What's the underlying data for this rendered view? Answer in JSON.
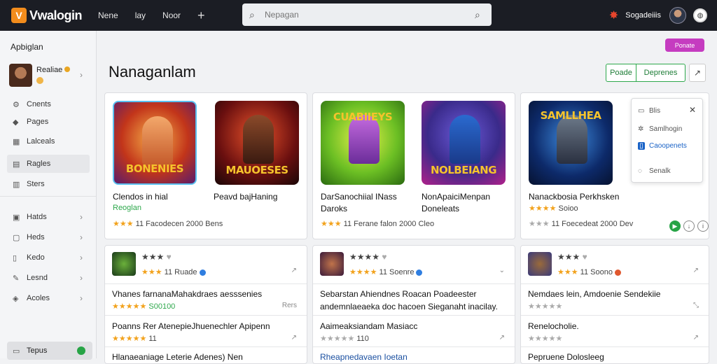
{
  "app": {
    "name": "Vwalogin",
    "logo_glyph": "V"
  },
  "topnav": {
    "items": [
      "Nene",
      "lay",
      "Noor"
    ],
    "plus": "+"
  },
  "search": {
    "placeholder": "Nepagan"
  },
  "user": {
    "name": "Sogadeiiis"
  },
  "sidebar": {
    "title": "Apbiglan",
    "profile_name": "Realiae",
    "items": [
      {
        "label": "Cnents",
        "icon": "gear-icon"
      },
      {
        "label": "Pages",
        "icon": "tag-icon"
      },
      {
        "label": "Lalceals",
        "icon": "grid-icon"
      },
      {
        "label": "Ragles",
        "icon": "list-icon"
      },
      {
        "label": "Sters",
        "icon": "chart-icon"
      },
      {
        "label": "Hatds",
        "icon": "box-icon"
      },
      {
        "label": "Heds",
        "icon": "window-icon"
      },
      {
        "label": "Kedo",
        "icon": "doc-icon"
      },
      {
        "label": "Lesnd",
        "icon": "pen-icon"
      },
      {
        "label": "Acoles",
        "icon": "layers-icon"
      }
    ],
    "footer": "Tepus"
  },
  "main": {
    "title": "Nanaganlam",
    "pill": "Ponate",
    "btn_a": "Poade",
    "btn_b": "Deprenes"
  },
  "featured": [
    {
      "thumb_text": "BONENIES",
      "title": "Clendos in  hial",
      "sub": "Reoglan",
      "stars": "★★★",
      "rating": "11  Facodecen    2000 Bens"
    },
    {
      "thumb_text": "MAUOESES",
      "title": "Peavd bajHaning",
      "sub": "",
      "stars": "",
      "rating": ""
    },
    {
      "thumb_text": "CUABIIEYS",
      "title": "DarSanochiial  INass",
      "sub": "Daroks",
      "stars": "★★★",
      "rating": "11  Ferane falon     2000 Cleo"
    },
    {
      "thumb_text": "NOLBEIANG",
      "title": "NonApaiciMenpan",
      "sub": "Doneleats",
      "stars": "",
      "rating": ""
    },
    {
      "thumb_text": "SAMLLHEA",
      "title": "Nanackbosia  Perkhsken",
      "sub": "Soioo",
      "stars": "★★★★",
      "rating": "11  Foecedeat    2000  Dev"
    }
  ],
  "popover": {
    "r1": "Blis",
    "r2": "Samlhogin",
    "r3": "Caoopenets",
    "r4": "Senalk"
  },
  "list_cards": [
    {
      "head_stars": "★★★",
      "head_meta": "11  Ruade",
      "rows": [
        {
          "text": "Vhanes  farnanaMahakdraes aesssenies",
          "meta": "S00100",
          "right": "Rers"
        },
        {
          "text": "Poanns  Rer  AtenepieJhuenechler  Apipenn",
          "meta": "11",
          "right": ""
        },
        {
          "text": "Hlanaeaniage  Leterie  Adenes)  Nen",
          "meta": "",
          "right": ""
        }
      ]
    },
    {
      "head_stars": "★★★★",
      "head_meta": "11  Soenre",
      "rows": [
        {
          "text": "Sebarstan  Ahiendnes  Roacan  Poadeester",
          "meta": "",
          "right": ""
        },
        {
          "text": "andemnlaeaeka  doc hacoen  Sieganaht  inacilay.",
          "meta": "",
          "right": ""
        },
        {
          "text": "Aaimeaksiandam  Masiacc",
          "meta": "110",
          "right": ""
        },
        {
          "text": "Rheapnedavaen  Ioetan",
          "meta": "",
          "right": ""
        }
      ]
    },
    {
      "head_stars": "★★★",
      "head_meta": "11  Soono",
      "rows": [
        {
          "text": "Nemdaes lein,  Amdoenie  Sendekiie",
          "meta": "",
          "right": ""
        },
        {
          "text": "Renelocholie.",
          "meta": "",
          "right": ""
        },
        {
          "text": "Pepruene  Dolosleeg",
          "meta": "",
          "right": ""
        }
      ]
    }
  ],
  "colors": {
    "accent_green": "#2ea84c",
    "star": "#f2a21c",
    "pill": "#c53cc0",
    "topbar": "#1b1d24"
  }
}
